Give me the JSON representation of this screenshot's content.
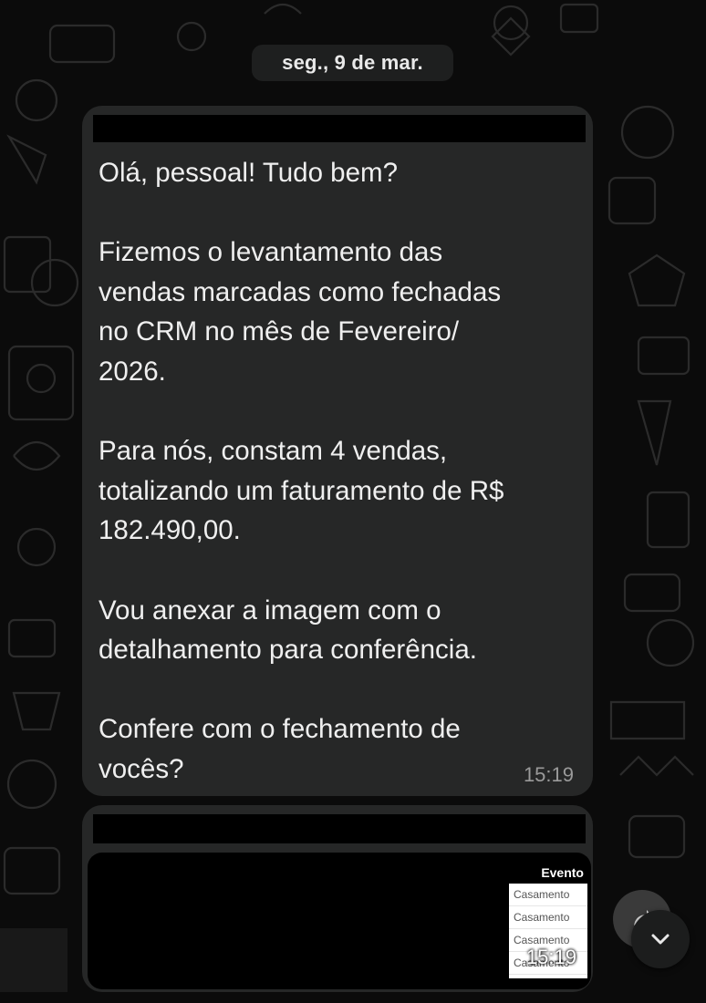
{
  "chat": {
    "date_separator": "seg., 9 de mar.",
    "messages": [
      {
        "text": "Olá, pessoal! Tudo bem?\n\nFizemos o levantamento das\nvendas marcadas como fechadas\nno CRM no mês de Fevereiro/\n2026.\n\nPara nós, constam 4 vendas,\ntotalizando um faturamento de R$\n182.490,00.\n\nVou anexar a imagem com o\ndetalhamento para conferência.\n\nConfere com o fechamento de\nvocês?",
        "time": "15:19"
      },
      {
        "type": "image",
        "time": "15:19",
        "preview": {
          "header": "Evento",
          "rows": [
            "Casamento",
            "Casamento",
            "Casamento",
            "Casamento"
          ]
        }
      }
    ]
  },
  "icons": {
    "share": "forward-arrow-icon",
    "scroll_down": "chevron-down-icon"
  },
  "colors": {
    "background": "#0b0b0b",
    "bubble": "#262727",
    "date_chip": "#1e1f1f",
    "timestamp": "#9a9a9a"
  }
}
